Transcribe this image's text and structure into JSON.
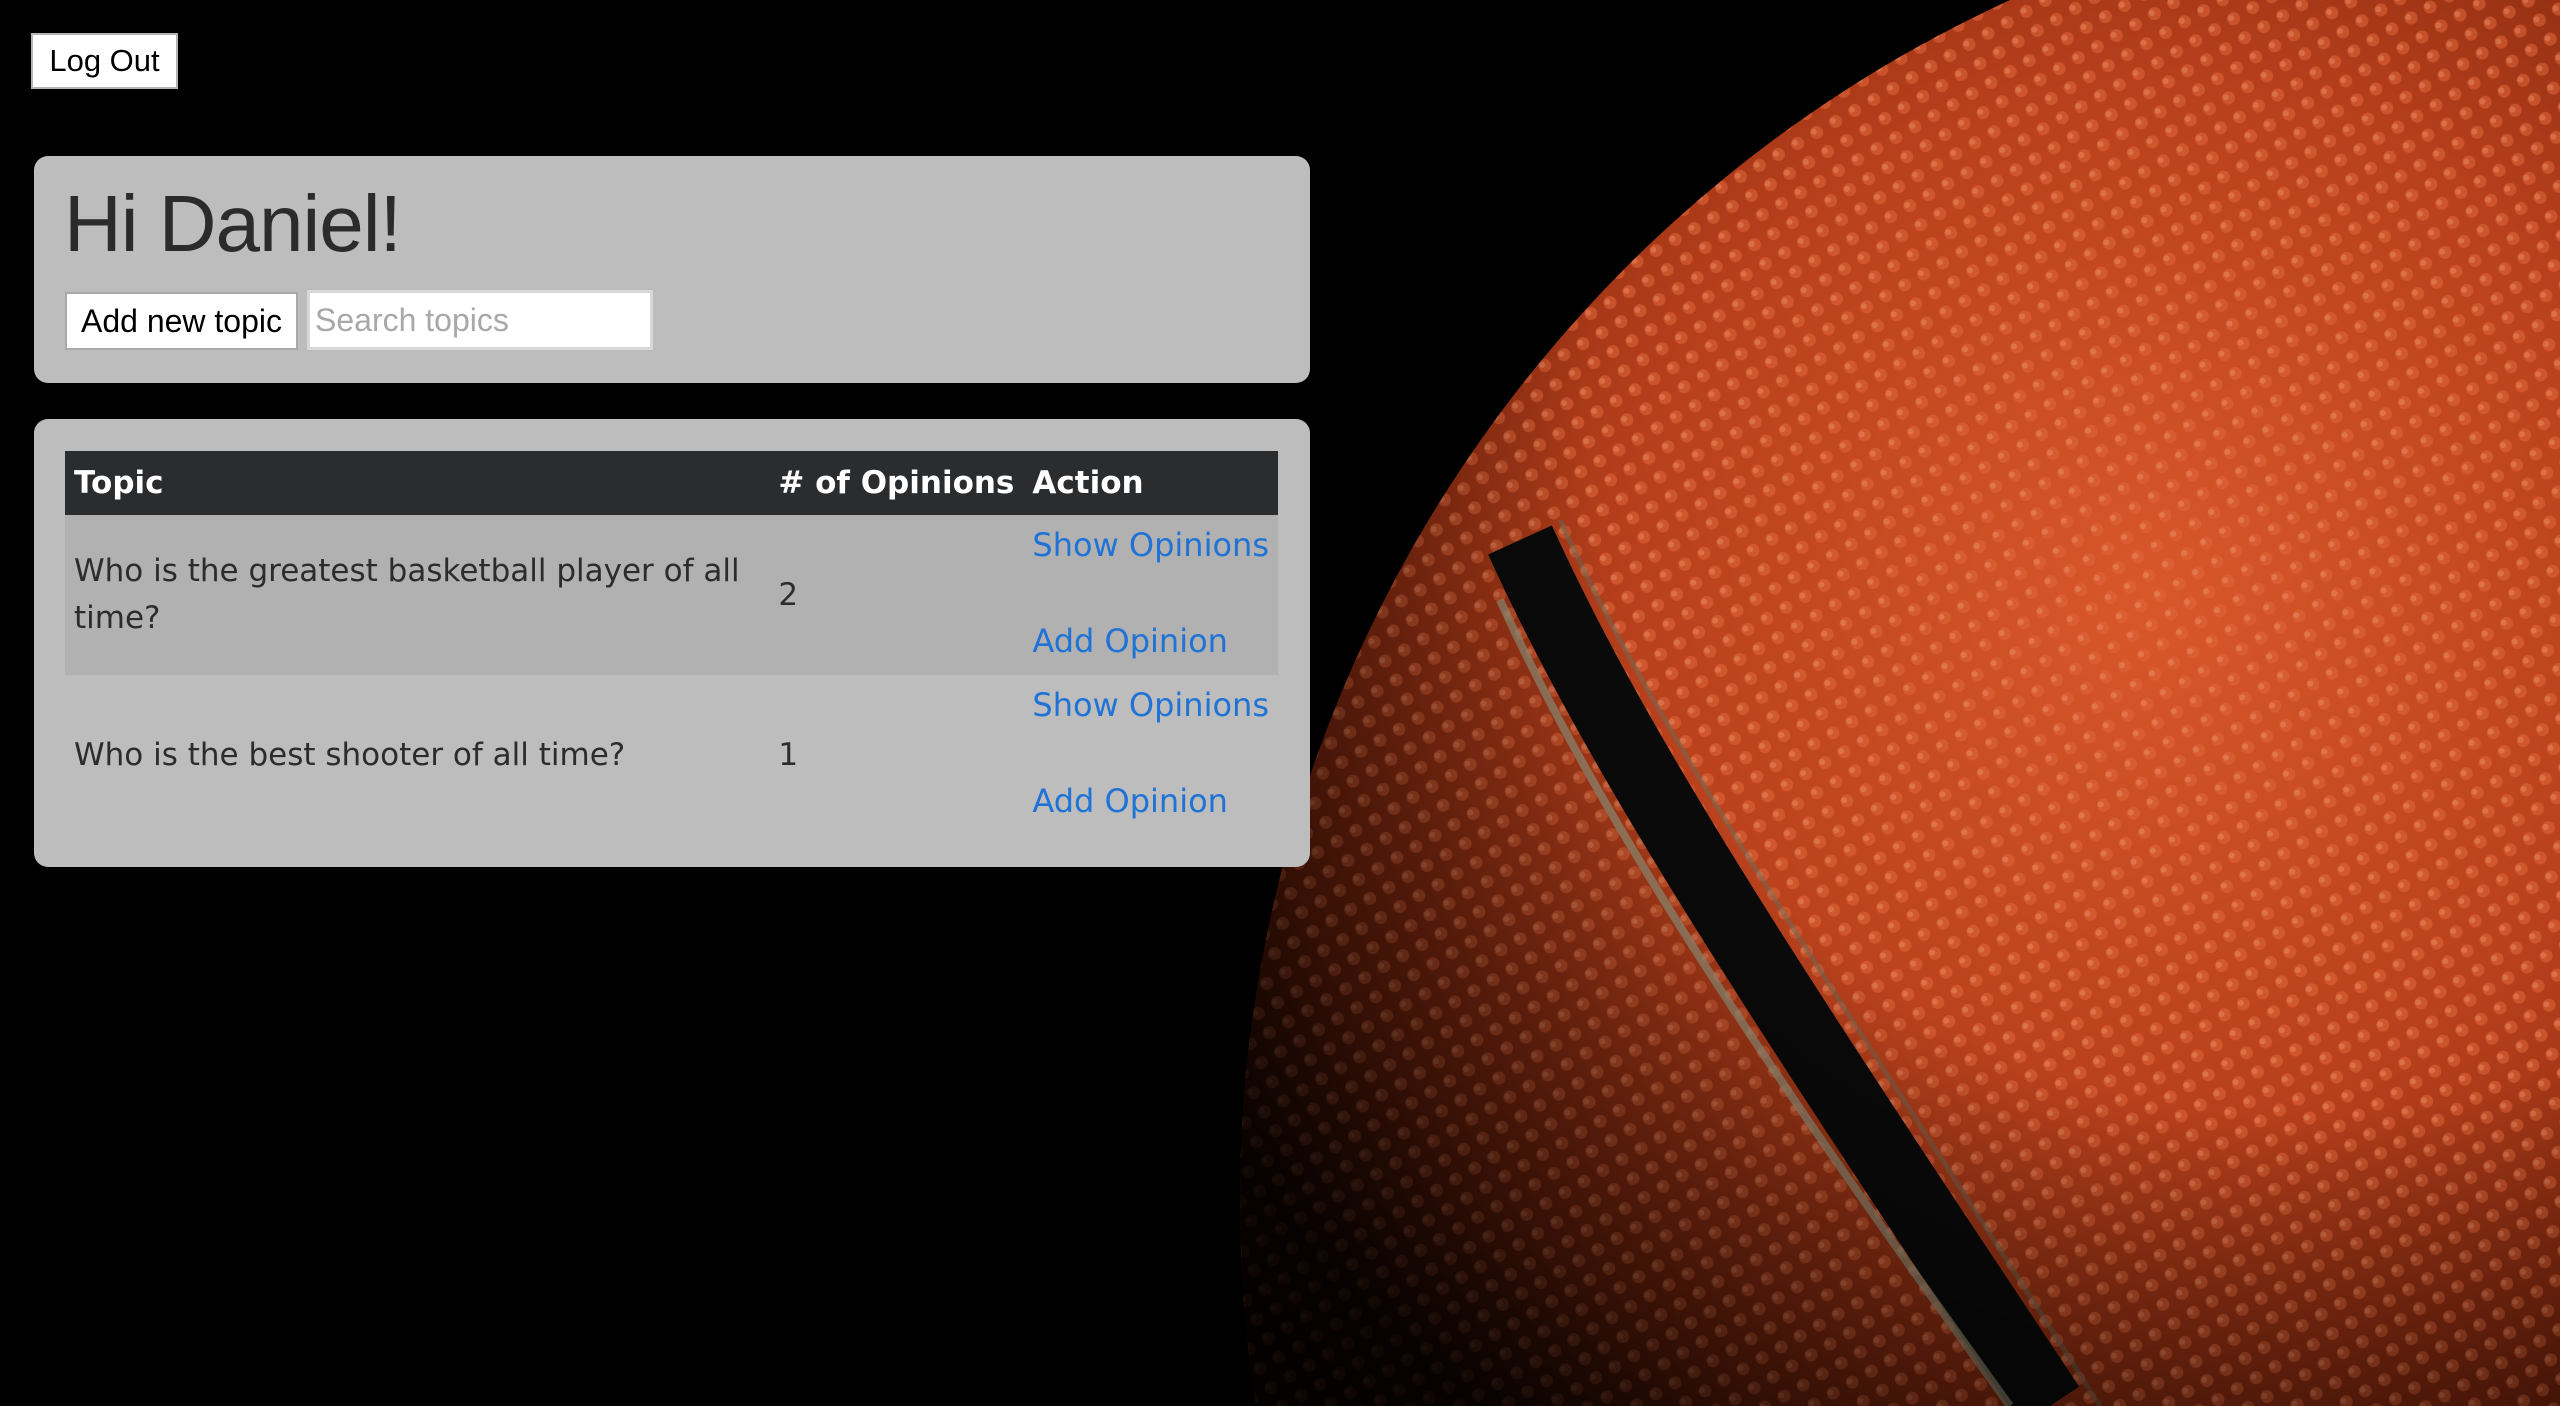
{
  "auth": {
    "logout_label": "Log Out"
  },
  "header": {
    "greeting": "Hi Daniel!",
    "add_topic_label": "Add new topic",
    "search_placeholder": "Search topics"
  },
  "table": {
    "columns": [
      "Topic",
      "# of Opinions",
      "Action"
    ],
    "rows": [
      {
        "topic": "Who is the greatest basketball player of all time?",
        "opinions": "2",
        "show_label": "Show Opinions",
        "add_label": "Add Opinion"
      },
      {
        "topic": "Who is the best shooter of all time?",
        "opinions": "1",
        "show_label": "Show Opinions",
        "add_label": "Add Opinion"
      }
    ]
  },
  "colors": {
    "background": "#000000",
    "panel": "#bdbdbd",
    "table_header": "#2b2c2e",
    "link": "#1f72d6",
    "ball": "#b8401c"
  },
  "background_image": "basketball-closeup"
}
